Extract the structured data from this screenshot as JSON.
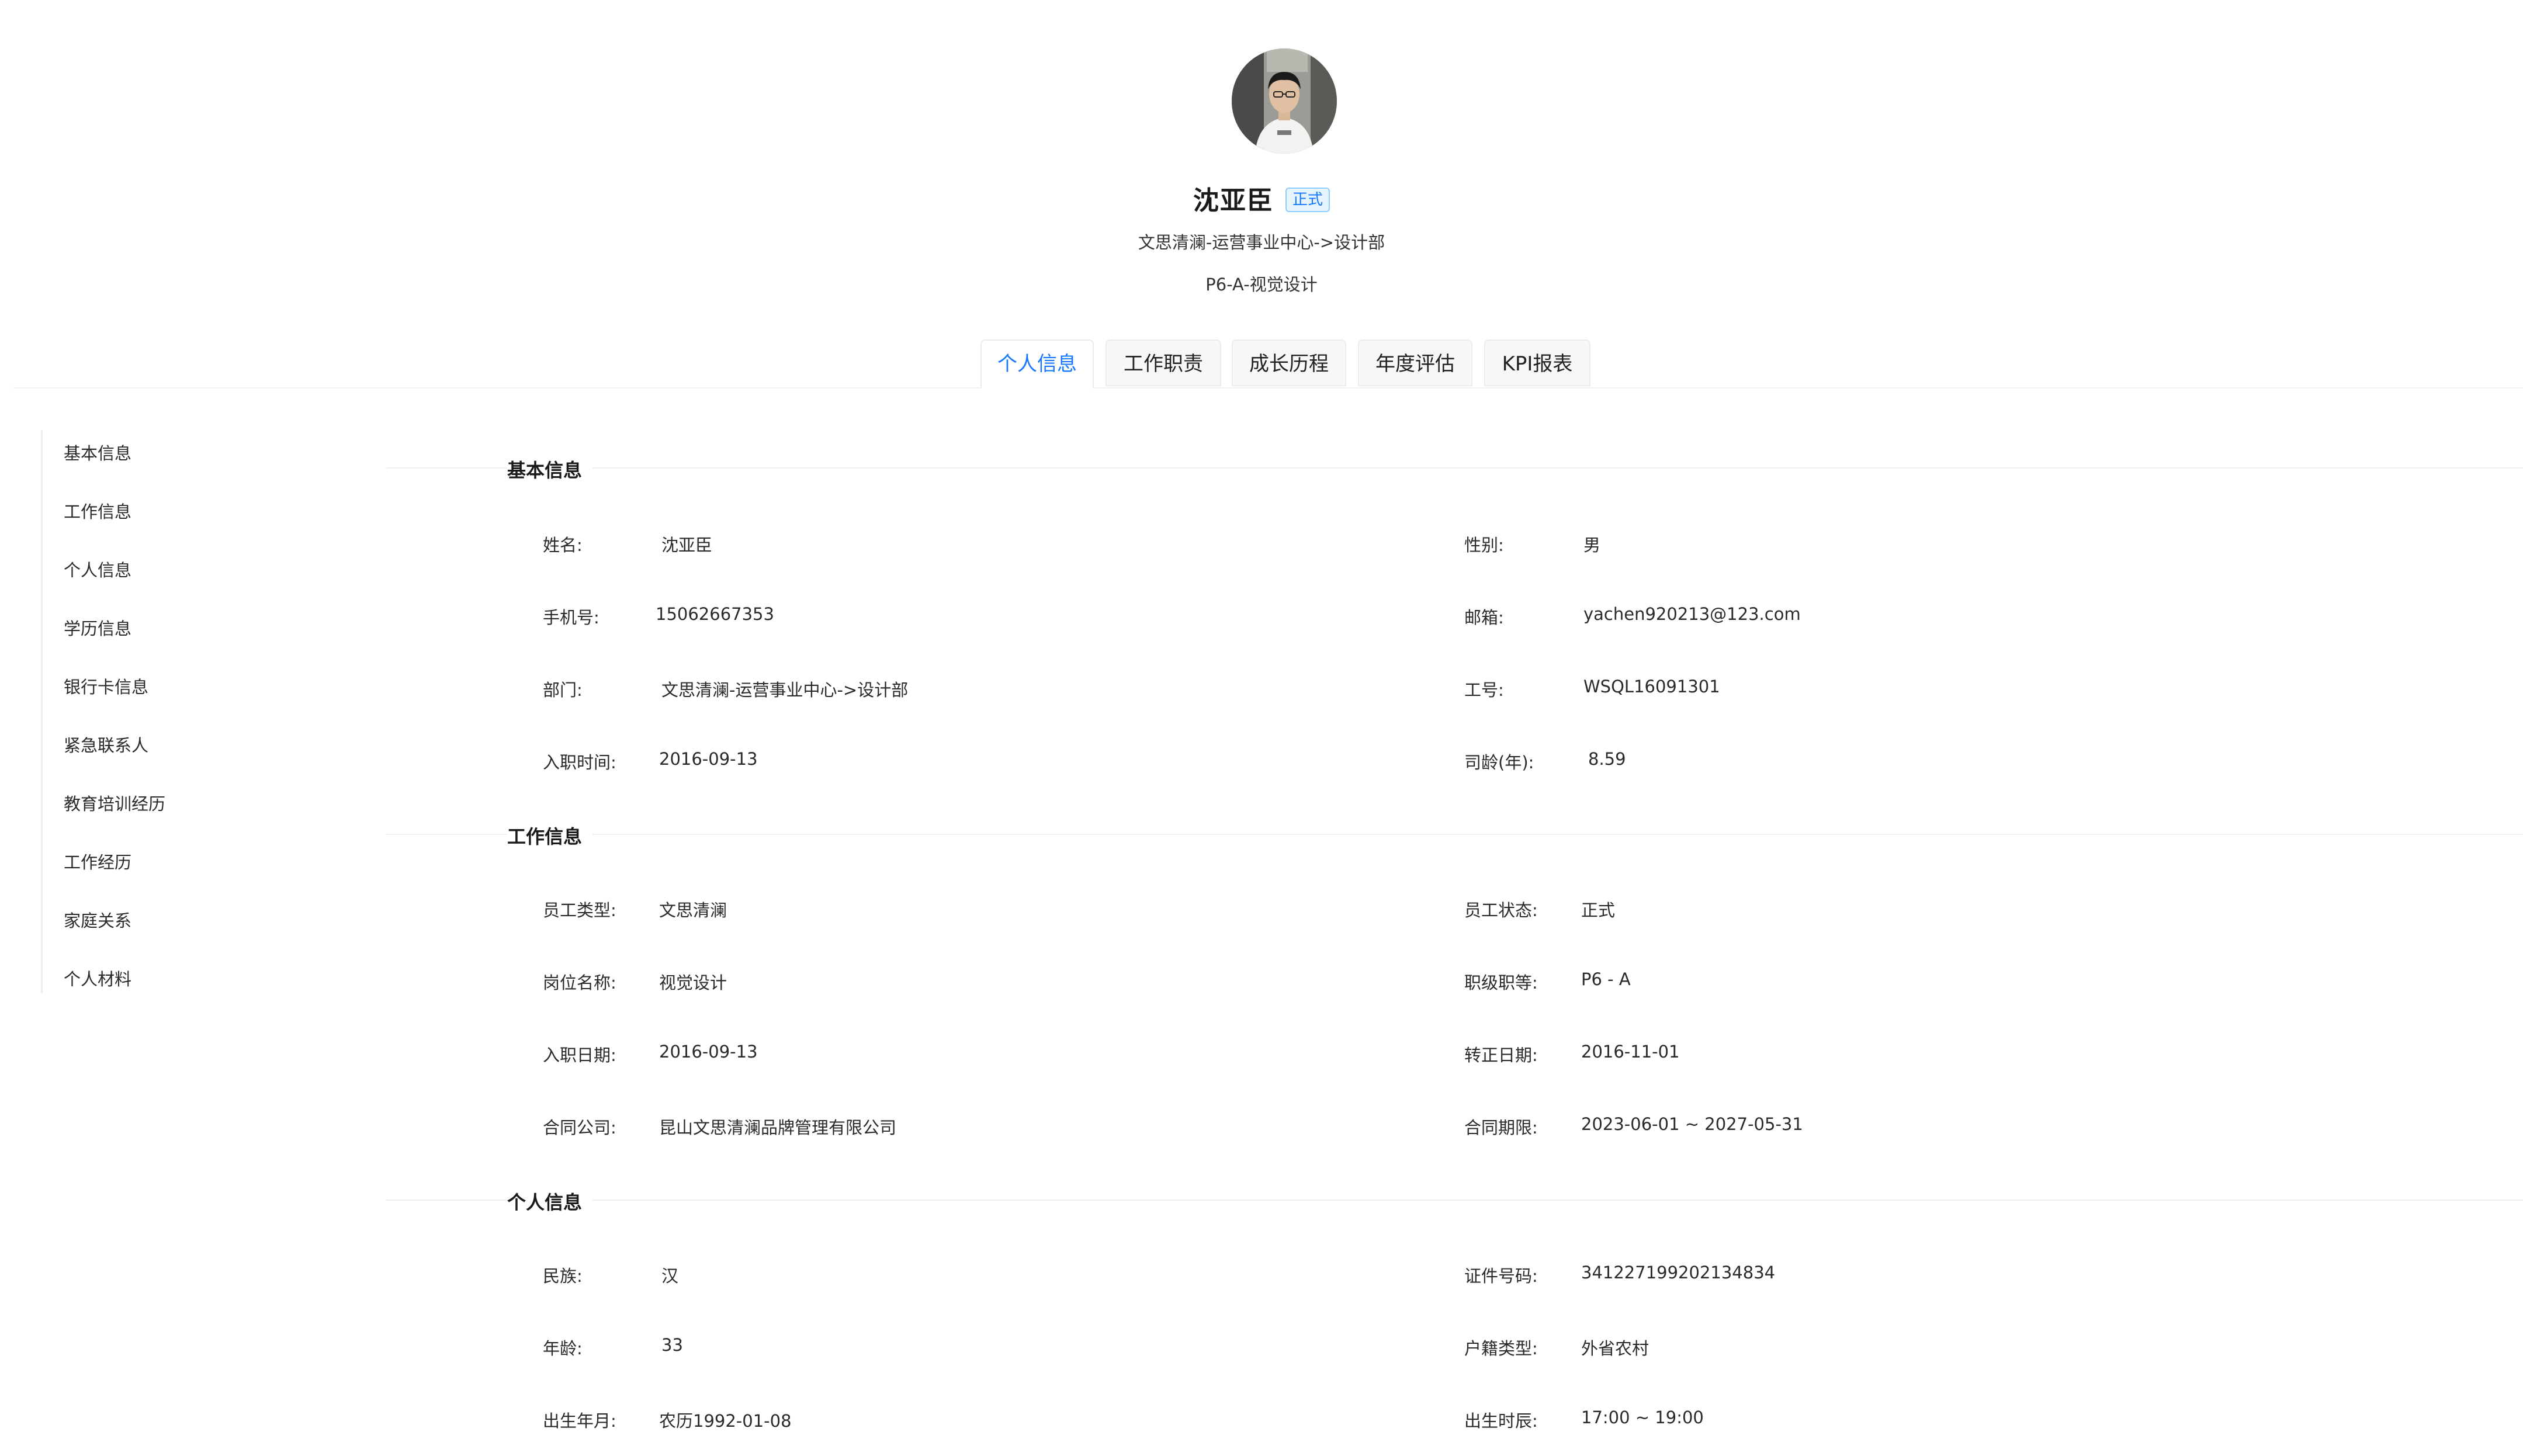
{
  "profile": {
    "name": "沈亚臣",
    "status_badge": "正式",
    "department_path": "文思清澜-运营事业中心->设计部",
    "level_title": "P6-A-视觉设计"
  },
  "tabs": [
    {
      "label": "个人信息",
      "active": true
    },
    {
      "label": "工作职责",
      "active": false
    },
    {
      "label": "成长历程",
      "active": false
    },
    {
      "label": "年度评估",
      "active": false
    },
    {
      "label": "KPI报表",
      "active": false
    }
  ],
  "side_nav": [
    {
      "label": "基本信息"
    },
    {
      "label": "工作信息"
    },
    {
      "label": "个人信息"
    },
    {
      "label": "学历信息"
    },
    {
      "label": "银行卡信息"
    },
    {
      "label": "紧急联系人"
    },
    {
      "label": "教育培训经历"
    },
    {
      "label": "工作经历"
    },
    {
      "label": "家庭关系"
    },
    {
      "label": "个人材料"
    }
  ],
  "sections": [
    {
      "title": "基本信息",
      "rows": [
        {
          "left": {
            "label": "姓名:",
            "value": "沈亚臣"
          },
          "right": {
            "label": "性别:",
            "value": "男"
          }
        },
        {
          "left": {
            "label": "手机号:",
            "value": "15062667353"
          },
          "right": {
            "label": "邮箱:",
            "value": "yachen920213@123.com"
          }
        },
        {
          "left": {
            "label": "部门:",
            "value": "文思清澜-运营事业中心->设计部"
          },
          "right": {
            "label": "工号:",
            "value": "WSQL16091301"
          }
        },
        {
          "left": {
            "label": "入职时间:",
            "value": "2016-09-13"
          },
          "right": {
            "label": "司龄(年):",
            "value": "8.59"
          }
        }
      ]
    },
    {
      "title": "工作信息",
      "rows": [
        {
          "left": {
            "label": "员工类型:",
            "value": "文思清澜"
          },
          "right": {
            "label": "员工状态:",
            "value": "正式"
          }
        },
        {
          "left": {
            "label": "岗位名称:",
            "value": "视觉设计"
          },
          "right": {
            "label": "职级职等:",
            "value": "P6 - A"
          }
        },
        {
          "left": {
            "label": "入职日期:",
            "value": "2016-09-13"
          },
          "right": {
            "label": "转正日期:",
            "value": "2016-11-01"
          }
        },
        {
          "left": {
            "label": "合同公司:",
            "value": "昆山文思清澜品牌管理有限公司"
          },
          "right": {
            "label": "合同期限:",
            "value": "2023-06-01 ~ 2027-05-31"
          }
        }
      ]
    },
    {
      "title": "个人信息",
      "rows": [
        {
          "left": {
            "label": "民族:",
            "value": "汉"
          },
          "right": {
            "label": "证件号码:",
            "value": "341227199202134834"
          }
        },
        {
          "left": {
            "label": "年龄:",
            "value": "33"
          },
          "right": {
            "label": "户籍类型:",
            "value": "外省农村"
          }
        },
        {
          "left": {
            "label": "出生年月:",
            "value": "农历1992-01-08"
          },
          "right": {
            "label": "出生时辰:",
            "value": "17:00 ~ 19:00"
          }
        }
      ]
    }
  ],
  "colors": {
    "accent": "#1677ff",
    "badge_bg": "#e6f4ff",
    "badge_border": "#91caff",
    "divider": "#f0f0f0"
  },
  "icons": {
    "avatar": "user-photo"
  }
}
